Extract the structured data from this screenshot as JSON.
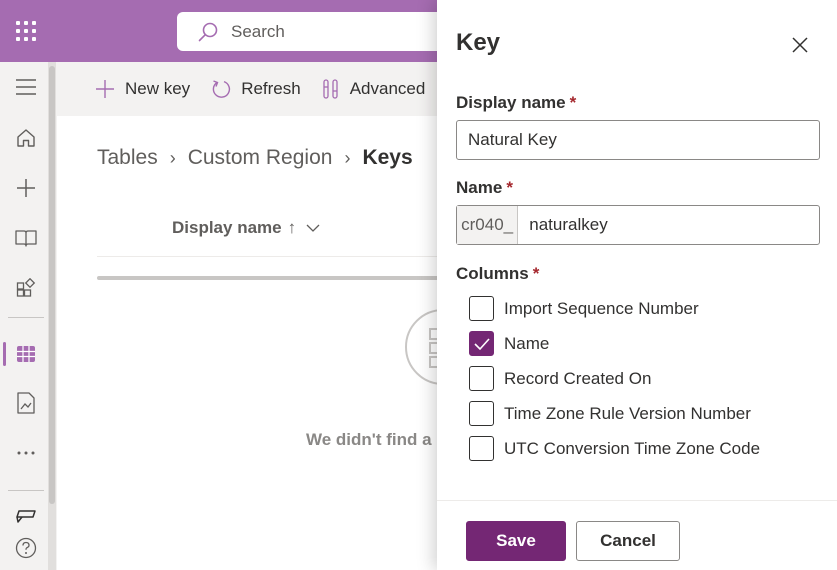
{
  "topbar": {
    "search_placeholder": "Search",
    "waffle_icon": "waffle-icon",
    "brand_color": "#a56cb1"
  },
  "rail": {
    "items": [
      {
        "name": "hamburger-icon"
      },
      {
        "name": "home-icon"
      },
      {
        "name": "plus-icon"
      },
      {
        "name": "book-icon"
      },
      {
        "name": "apps-icon"
      },
      {
        "name": "table-icon",
        "active": true
      },
      {
        "name": "report-icon"
      },
      {
        "name": "more-icon"
      },
      {
        "name": "chat-icon"
      },
      {
        "name": "help-icon"
      }
    ]
  },
  "commandbar": {
    "new_key": "New key",
    "refresh": "Refresh",
    "advanced": "Advanced"
  },
  "main": {
    "breadcrumb": [
      "Tables",
      "Custom Region",
      "Keys"
    ],
    "column_header": "Display name",
    "sort_indicator": "↑",
    "empty_text": "We didn't find a"
  },
  "panel": {
    "title": "Key",
    "display_name": {
      "label": "Display name",
      "required": "*",
      "value": "Natural Key"
    },
    "name": {
      "label": "Name",
      "required": "*",
      "prefix": "cr040_",
      "value": "naturalkey"
    },
    "columns": {
      "label": "Columns",
      "required": "*",
      "items": [
        {
          "label": "Import Sequence Number",
          "checked": false
        },
        {
          "label": "Name",
          "checked": true
        },
        {
          "label": "Record Created On",
          "checked": false
        },
        {
          "label": "Time Zone Rule Version Number",
          "checked": false
        },
        {
          "label": "UTC Conversion Time Zone Code",
          "checked": false
        }
      ]
    },
    "save_label": "Save",
    "cancel_label": "Cancel",
    "accent_color": "#742774"
  }
}
